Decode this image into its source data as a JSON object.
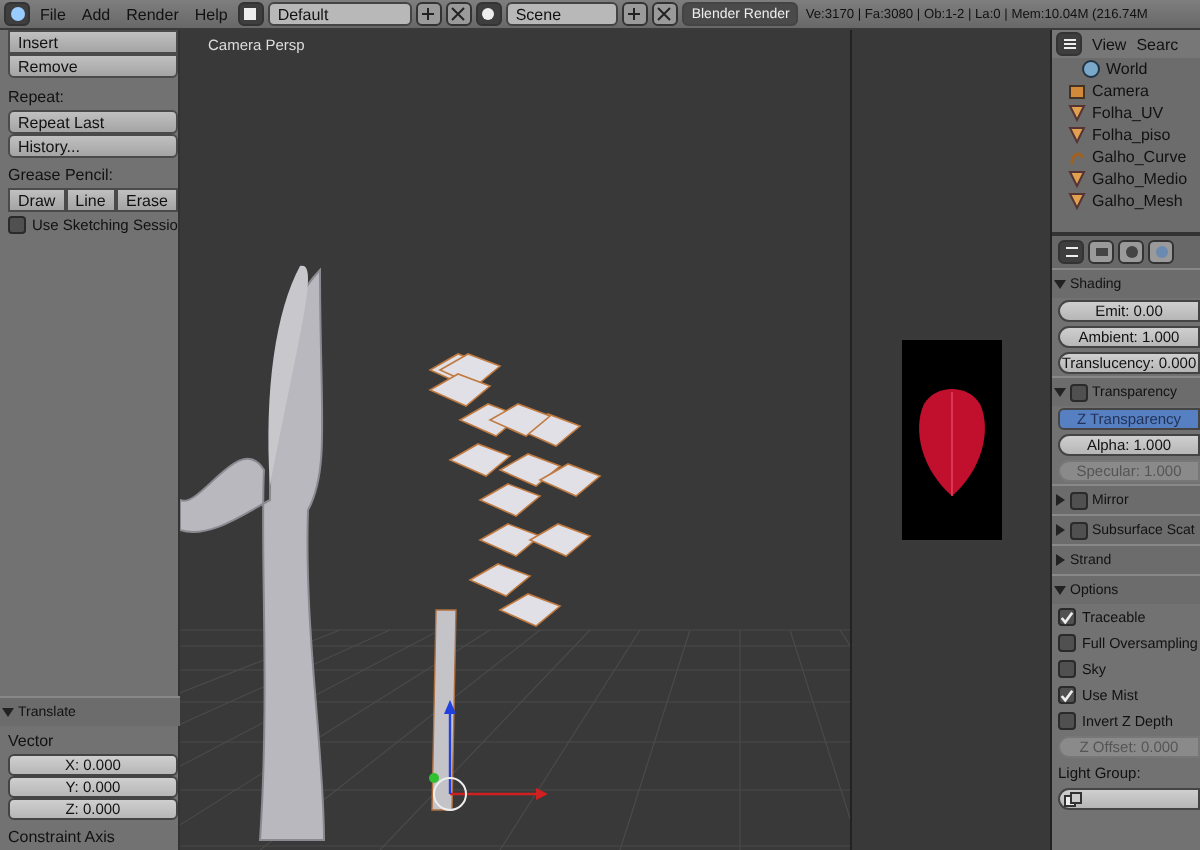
{
  "header": {
    "menus": [
      "File",
      "Add",
      "Render",
      "Help"
    ],
    "layout": "Default",
    "scene": "Scene",
    "engine": "Blender Render",
    "stats": "Ve:3170 | Fa:3080 | Ob:1-2 | La:0 | Mem:10.04M (216.74M"
  },
  "tool_panel": {
    "buttons": [
      "Insert",
      "Remove"
    ],
    "repeat_title": "Repeat:",
    "repeat_buttons": [
      "Repeat Last",
      "History..."
    ],
    "grease_title": "Grease Pencil:",
    "grease_buttons": [
      "Draw",
      "Line",
      "Erase"
    ],
    "sketch": {
      "label": "Use Sketching Sessio",
      "checked": false
    }
  },
  "operator_panel": {
    "title": "Translate",
    "expanded": true,
    "vector_label": "Vector",
    "fields": [
      "X: 0.000",
      "Y: 0.000",
      "Z: 0.000"
    ],
    "constraint_label": "Constraint Axis"
  },
  "viewport": {
    "label": "Camera Persp"
  },
  "outliner": {
    "menus": [
      "View",
      "Searc"
    ],
    "items": [
      {
        "name": "World",
        "kind": "world"
      },
      {
        "name": "Camera",
        "kind": "camera"
      },
      {
        "name": "Folha_UV",
        "kind": "mesh"
      },
      {
        "name": "Folha_piso",
        "kind": "mesh"
      },
      {
        "name": "Galho_Curve",
        "kind": "curve"
      },
      {
        "name": "Galho_Medio",
        "kind": "mesh"
      },
      {
        "name": "Galho_Mesh",
        "kind": "mesh"
      }
    ]
  },
  "properties": {
    "panels": [
      {
        "title": "Shading",
        "expanded": true,
        "rows": [
          {
            "kind": "number",
            "label": "Emit: 0.00",
            "disabled": false
          },
          {
            "kind": "number",
            "label": "Ambient: 1.000",
            "disabled": false
          },
          {
            "kind": "number",
            "label": "Translucency: 0.000",
            "disabled": false
          }
        ]
      },
      {
        "title": "Transparency",
        "expanded": true,
        "toggle": false,
        "rows": [
          {
            "kind": "toggle",
            "label": "Z Transparency",
            "selected": true
          },
          {
            "kind": "number",
            "label": "Alpha: 1.000",
            "disabled": false
          },
          {
            "kind": "number",
            "label": "Specular: 1.000",
            "disabled": true
          }
        ]
      },
      {
        "title": "Mirror",
        "expanded": false,
        "toggle": false
      },
      {
        "title": "Subsurface Scat",
        "expanded": false,
        "toggle": false
      },
      {
        "title": "Strand",
        "expanded": false
      },
      {
        "title": "Options",
        "expanded": true,
        "rows": [
          {
            "kind": "checkbox",
            "label": "Traceable",
            "checked": true
          },
          {
            "kind": "checkbox",
            "label": "Full Oversampling",
            "checked": false
          },
          {
            "kind": "checkbox",
            "label": "Sky",
            "checked": false
          },
          {
            "kind": "checkbox",
            "label": "Use Mist",
            "checked": true
          },
          {
            "kind": "checkbox",
            "label": "Invert Z Depth",
            "checked": false
          },
          {
            "kind": "number",
            "label": "Z Offset: 0.000",
            "disabled": true
          },
          {
            "kind": "label",
            "label": "Light Group:"
          },
          {
            "kind": "field"
          }
        ]
      }
    ]
  }
}
